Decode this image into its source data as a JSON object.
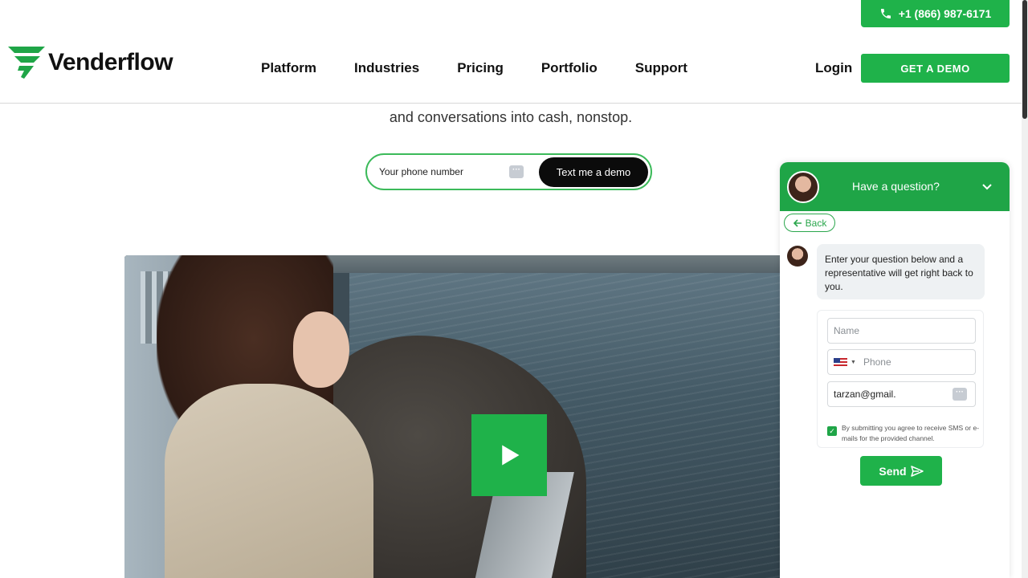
{
  "header": {
    "phone": "+1 (866) 987-6171",
    "brand": "Venderflow",
    "nav": [
      "Platform",
      "Industries",
      "Pricing",
      "Portfolio",
      "Support"
    ],
    "login": "Login",
    "demo_label": "GET A DEMO"
  },
  "hero": {
    "subtitle": "and conversations into cash, nonstop.",
    "phone_placeholder": "Your phone number",
    "text_demo_label": "Text me a demo"
  },
  "chat": {
    "title": "Have a question?",
    "back_label": "Back",
    "message": "Enter your question below and a representative will get right back to you.",
    "name_placeholder": "Name",
    "phone_placeholder": "Phone",
    "email_value": "tarzan@gmail.",
    "consent": "By submitting you agree to receive SMS or e-mails for the provided channel.",
    "send_label": "Send"
  },
  "colors": {
    "brand_green": "#1fb24a",
    "chat_green": "#1fa547"
  }
}
